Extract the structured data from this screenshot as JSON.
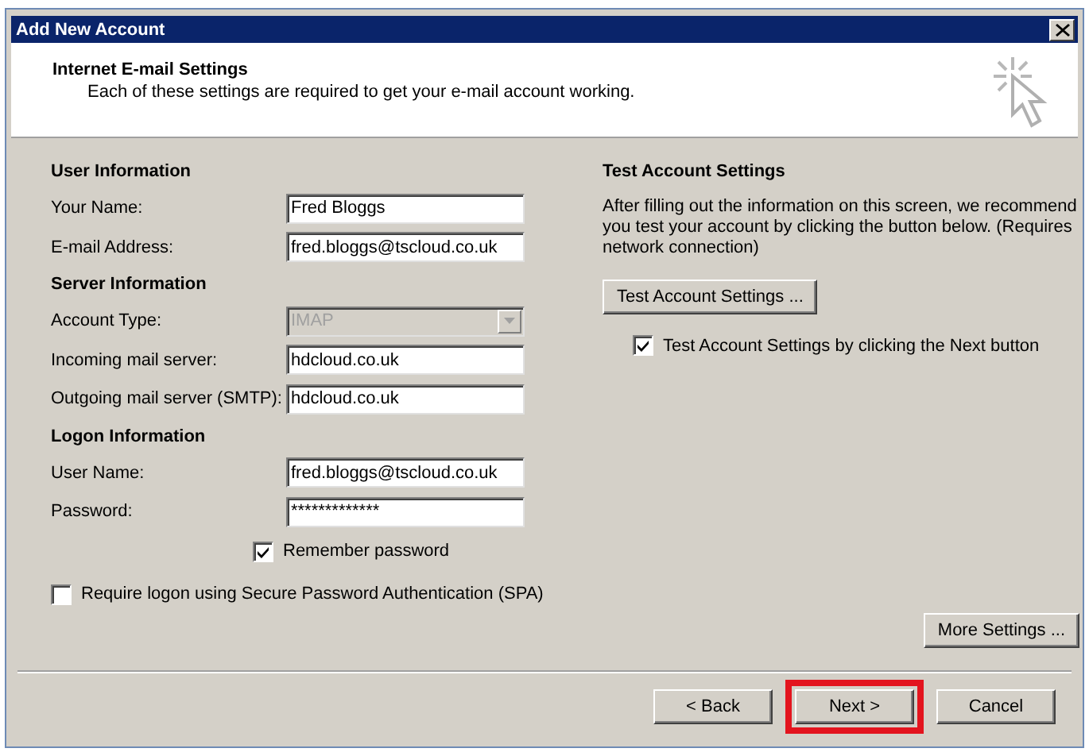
{
  "window": {
    "title": "Add New Account"
  },
  "header": {
    "title": "Internet E-mail Settings",
    "subtitle": "Each of these settings are required to get your e-mail account working."
  },
  "sections": [
    {
      "heading": "User Information",
      "fields": [
        {
          "label": "Your Name:",
          "value": "Fred Bloggs",
          "kind": "text",
          "disabled": false
        },
        {
          "label": "E-mail Address:",
          "value": "fred.bloggs@tscloud.co.uk",
          "kind": "text",
          "disabled": false
        }
      ]
    },
    {
      "heading": "Server Information",
      "fields": [
        {
          "label": "Account Type:",
          "value": "IMAP",
          "kind": "dropdown",
          "disabled": true
        },
        {
          "label": "Incoming mail server:",
          "value": "hdcloud.co.uk",
          "kind": "text",
          "disabled": false
        },
        {
          "label": "Outgoing mail server (SMTP):",
          "value": "hdcloud.co.uk",
          "kind": "text",
          "disabled": false
        }
      ]
    },
    {
      "heading": "Logon Information",
      "fields": [
        {
          "label": "User Name:",
          "value": "fred.bloggs@tscloud.co.uk",
          "kind": "text",
          "disabled": false
        },
        {
          "label": "Password:",
          "value": "*************",
          "kind": "password",
          "disabled": false
        }
      ]
    }
  ],
  "remember_password": {
    "label": "Remember password",
    "checked": true
  },
  "spa": {
    "label": "Require logon using Secure Password Authentication (SPA)",
    "checked": false
  },
  "test": {
    "heading": "Test Account Settings",
    "description": "After filling out the information on this screen, we recommend you test your account by clicking the button below. (Requires network connection)",
    "button": "Test Account Settings ...",
    "checkbox": {
      "label": "Test Account Settings by clicking the Next button",
      "checked": true
    }
  },
  "more_settings": "More Settings ...",
  "buttons": [
    {
      "label": "< Back",
      "highlighted": false
    },
    {
      "label": "Next >",
      "highlighted": true
    },
    {
      "label": "Cancel",
      "highlighted": false
    }
  ]
}
